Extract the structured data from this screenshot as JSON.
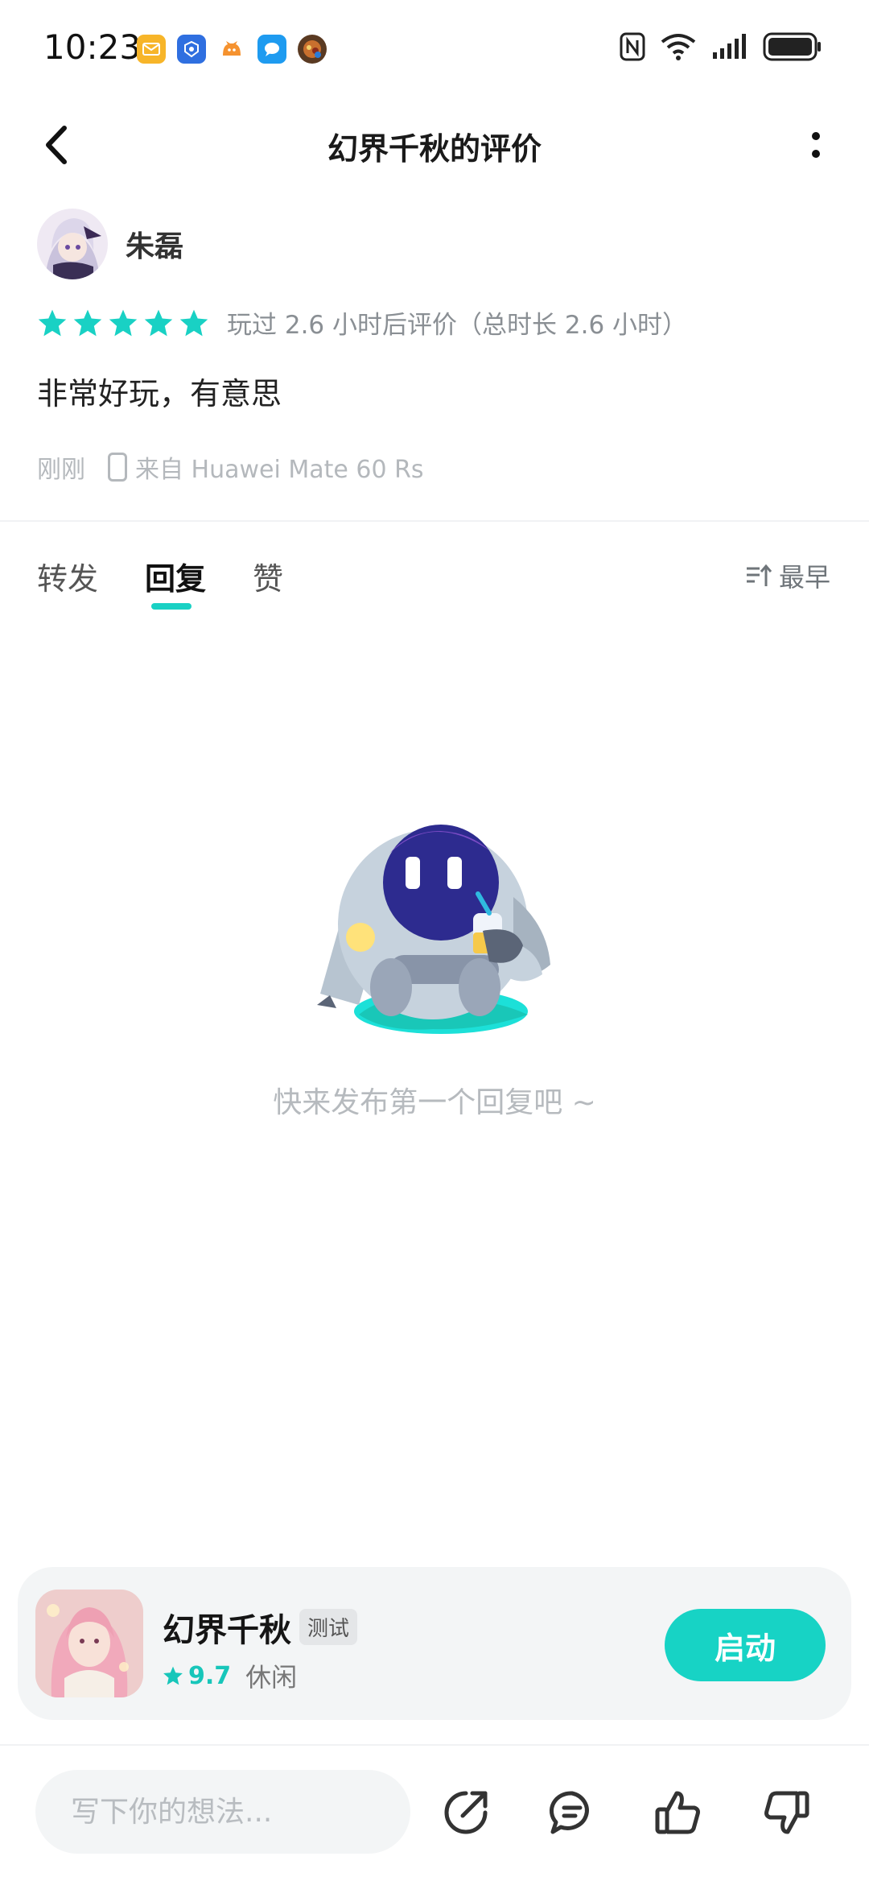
{
  "status_bar": {
    "time": "10:23",
    "notification_icons": [
      "mail-app-icon",
      "cloud-app-icon",
      "fox-app-icon",
      "chat-app-icon",
      "game-app-icon"
    ],
    "system_icons": [
      "nfc-icon",
      "wifi-icon",
      "signal-icon",
      "battery-icon"
    ]
  },
  "header": {
    "title": "幻界千秋的评价"
  },
  "review": {
    "username": "朱磊",
    "rating": 5,
    "play_info": "玩过 2.6 小时后评价（总时长 2.6 小时）",
    "content": "非常好玩，有意思",
    "time": "刚刚",
    "device": "来自 Huawei Mate 60 Rs"
  },
  "tabs": [
    {
      "label": "转发",
      "active": false
    },
    {
      "label": "回复",
      "active": true
    },
    {
      "label": "赞",
      "active": false
    }
  ],
  "sort": {
    "label": "最早"
  },
  "empty_state": {
    "message": "快来发布第一个回复吧 ~"
  },
  "game_card": {
    "name": "幻界千秋",
    "badge": "测试",
    "score": "9.7",
    "category": "休闲",
    "launch_label": "启动"
  },
  "bottom_bar": {
    "input_placeholder": "写下你的想法..."
  },
  "colors": {
    "accent": "#17d3c5",
    "star": "#19d1c4",
    "muted_text": "#8a8f94"
  }
}
